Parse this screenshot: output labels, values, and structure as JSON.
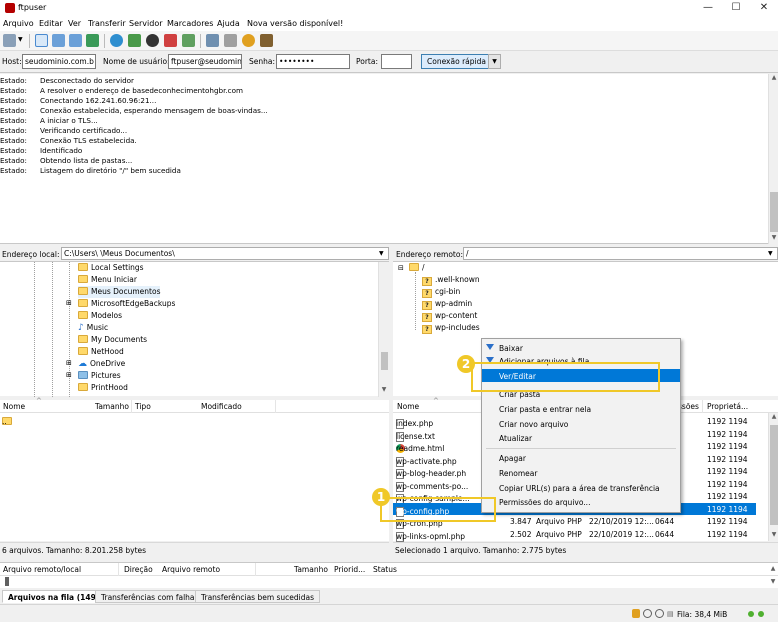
{
  "window": {
    "title": "ftpuser",
    "minimize": "—",
    "maximize": "☐",
    "close": "✕"
  },
  "menu": [
    "Arquivo",
    "Editar",
    "Ver",
    "Transferir",
    "Servidor",
    "Marcadores",
    "Ajuda",
    "Nova versão disponível!"
  ],
  "quickconnect": {
    "host_label": "Host:",
    "host_value": "seudominio.com.b",
    "user_label": "Nome de usuário:",
    "user_value": "ftpuser@seudomin",
    "pass_label": "Senha:",
    "pass_value": "••••••••",
    "port_label": "Porta:",
    "port_value": "",
    "button": "Conexão rápida",
    "dropdown": "▼"
  },
  "log": [
    {
      "k": "Estado:",
      "v": "Desconectado do servidor"
    },
    {
      "k": "Estado:",
      "v": "A resolver o endereço de basedeconhecimentohgbr.com"
    },
    {
      "k": "Estado:",
      "v": "Conectando 162.241.60.96:21..."
    },
    {
      "k": "Estado:",
      "v": "Conexão estabelecida, esperando mensagem de boas-vindas..."
    },
    {
      "k": "Estado:",
      "v": "A iniciar o TLS..."
    },
    {
      "k": "Estado:",
      "v": "Verificando certificado..."
    },
    {
      "k": "Estado:",
      "v": "Conexão TLS estabelecida."
    },
    {
      "k": "Estado:",
      "v": "Identificado"
    },
    {
      "k": "Estado:",
      "v": "Obtendo lista de pastas..."
    },
    {
      "k": "Estado:",
      "v": "Listagem do diretório \"/\" bem sucedida"
    }
  ],
  "local": {
    "path_label": "Endereço local:",
    "path_value": "C:\\Users\\          \\Meus Documentos\\",
    "tree": [
      "Local Settings",
      "Menu Iniciar",
      "Meus Documentos",
      "MicrosoftEdgeBackups",
      "Modelos",
      "Music",
      "My Documents",
      "NetHood",
      "OneDrive",
      "Pictures",
      "PrintHood"
    ],
    "columns": [
      "Nome",
      "Tamanho",
      "Tipo",
      "Modificado"
    ],
    "rows": [
      ".."
    ],
    "status": "6 arquivos. Tamanho: 8.201.258 bytes"
  },
  "remote": {
    "path_label": "Endereço remoto:",
    "path_value": "/",
    "tree_root": "/",
    "tree": [
      ".well-known",
      "cgi-bin",
      "wp-admin",
      "wp-content",
      "wp-includes"
    ],
    "columns": [
      "Nome",
      "ssões",
      "Proprietá..."
    ],
    "rows": [
      {
        "name": "index.php",
        "perm": "",
        "owner": "1192 1194"
      },
      {
        "name": "license.txt",
        "perm": "",
        "owner": "1192 1194"
      },
      {
        "name": "readme.html",
        "perm": "",
        "owner": "1192 1194"
      },
      {
        "name": "wp-activate.php",
        "perm": "",
        "owner": "1192 1194"
      },
      {
        "name": "wp-blog-header.ph",
        "perm": "",
        "owner": "1192 1194"
      },
      {
        "name": "wp-comments-po...",
        "perm": "",
        "owner": "1192 1194"
      },
      {
        "name": "wp-config-sample...",
        "perm": "",
        "owner": "1192 1194"
      },
      {
        "name": "wp-config.php",
        "perm": "",
        "owner": "1192 1194"
      },
      {
        "name": "wp-cron.php",
        "size": "3.847",
        "type": "Arquivo PHP",
        "date": "22/10/2019 12:...",
        "perm": "0644",
        "owner": "1192 1194"
      },
      {
        "name": "wp-links-opml.php",
        "size": "2.502",
        "type": "Arquivo PHP",
        "date": "22/10/2019 12:...",
        "perm": "0644",
        "owner": "1192 1194"
      }
    ],
    "status": "Selecionado 1 arquivo. Tamanho: 2.775 bytes"
  },
  "context_menu": [
    "Baixar",
    "Adicionar arquivos à fila",
    "Ver/Editar",
    "Criar pasta",
    "Criar pasta e entrar nela",
    "Criar novo arquivo",
    "Atualizar",
    "Apagar",
    "Renomear",
    "Copiar URL(s) para a área de transferência",
    "Permissões do arquivo..."
  ],
  "callouts": [
    "1",
    "2"
  ],
  "queue": {
    "columns": [
      "Arquivo remoto/local",
      "Direção",
      "Arquivo remoto",
      "Tamanho",
      "Priorid...",
      "Status"
    ]
  },
  "tabs": [
    "Arquivos na fila (1496)",
    "Transferências com falha",
    "Transferências bem sucedidas"
  ],
  "statusbar": {
    "queue": "Fila: 38,4 MiB"
  },
  "colors": {
    "selection": "#0078d7",
    "callout": "#f0c828"
  }
}
